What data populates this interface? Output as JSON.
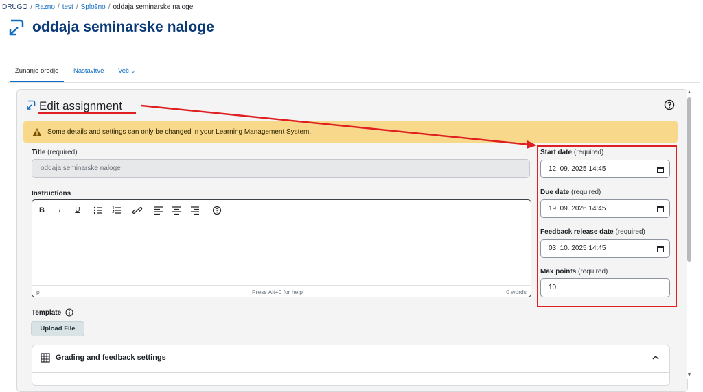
{
  "breadcrumb": [
    "DRUGO",
    "Razno",
    "test",
    "Splošno",
    "oddaja seminarske naloge"
  ],
  "page_title": "oddaja seminarske naloge",
  "tabs": [
    {
      "label": "Zunanje orodje",
      "active": true
    },
    {
      "label": "Nastavitve",
      "active": false
    },
    {
      "label": "Več",
      "active": false
    }
  ],
  "edit_title": "Edit assignment",
  "alert_text": "Some details and settings can only be changed in your Learning Management System.",
  "title_field": {
    "label": "Title",
    "req": "(required)",
    "value": "oddaja seminarske naloge"
  },
  "instructions": {
    "label": "Instructions",
    "toolbar": [
      "bold-icon",
      "italic-icon",
      "underline-icon",
      "bullet-list-icon",
      "numbered-list-icon",
      "link-icon",
      "align-left-icon",
      "align-center-icon",
      "align-right-icon",
      "help-icon"
    ],
    "status_path": "p",
    "status_help": "Press Alt+0 for help",
    "word_count": "0 words"
  },
  "template": {
    "label": "Template",
    "upload_label": "Upload File"
  },
  "grading_section": {
    "title": "Grading and feedback settings"
  },
  "right_fields": {
    "start": {
      "label": "Start date",
      "req": "(required)",
      "value": "12. 09. 2025 14:45"
    },
    "due": {
      "label": "Due date",
      "req": "(required)",
      "value": "19. 09. 2026 14:45"
    },
    "feedback": {
      "label": "Feedback release date",
      "req": "(required)",
      "value": "03. 10. 2025 14:45"
    },
    "points": {
      "label": "Max points",
      "req": "(required)",
      "value": "10"
    }
  },
  "colors": {
    "accent": "#0f6cbf",
    "annotation": "#e02020",
    "alert_bg": "#f8d98b"
  }
}
